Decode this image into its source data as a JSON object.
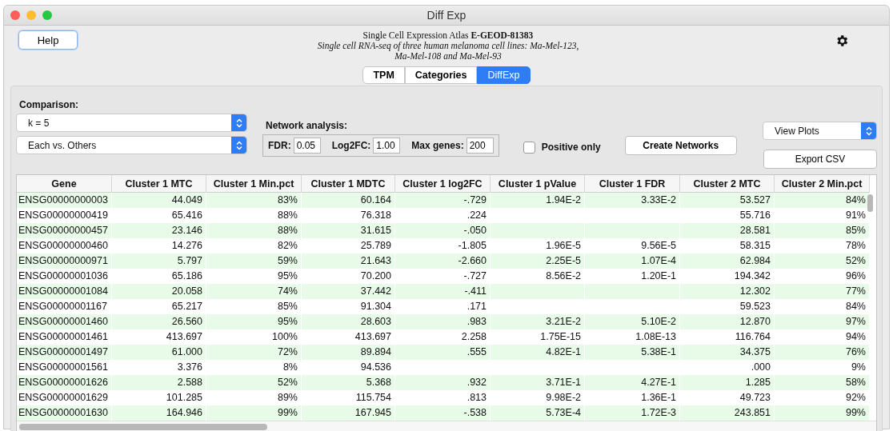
{
  "window": {
    "title": "Diff Exp"
  },
  "header": {
    "help_button": "Help",
    "atlas_line": "Single Cell Expression Atlas **E-GEOD-81383**",
    "description_lines": [
      "Single cell RNA-seq of three human melanoma cell lines: Ma-Mel-123,",
      "Ma-Mel-108 and Ma-Mel-93"
    ]
  },
  "tabs": [
    {
      "label": "TPM",
      "selected": false
    },
    {
      "label": "Categories",
      "selected": false
    },
    {
      "label": "DiffExp",
      "selected": true
    }
  ],
  "comparison": {
    "label": "Comparison:",
    "k_select": "k = 5",
    "mode_select": "Each vs. Others"
  },
  "network_analysis": {
    "label": "Network analysis:",
    "fields": [
      {
        "label": "FDR:",
        "value": "0.05"
      },
      {
        "label": "Log2FC:",
        "value": "1.00"
      },
      {
        "label": "Max genes:",
        "value": "200"
      }
    ]
  },
  "positive_only": {
    "label": "Positive only",
    "checked": false
  },
  "buttons": {
    "create_networks": "Create Networks",
    "export_csv": "Export CSV",
    "view_plots_select": "View Plots"
  },
  "table": {
    "columns": [
      "Gene",
      "Cluster 1 MTC",
      "Cluster 1 Min.pct",
      "Cluster 1 MDTC",
      "Cluster 1 log2FC",
      "Cluster 1 pValue",
      "Cluster 1 FDR",
      "Cluster 2 MTC",
      "Cluster 2 Min.pct"
    ],
    "rows": [
      [
        "ENSG00000000003",
        "44.049",
        "83%",
        "60.164",
        "-.729",
        "1.94E-2",
        "3.33E-2",
        "53.527",
        "84%"
      ],
      [
        "ENSG00000000419",
        "65.416",
        "88%",
        "76.318",
        ".224",
        null,
        null,
        "55.716",
        "91%"
      ],
      [
        "ENSG00000000457",
        "23.146",
        "88%",
        "31.615",
        "-.050",
        null,
        null,
        "28.581",
        "85%"
      ],
      [
        "ENSG00000000460",
        "14.276",
        "82%",
        "25.789",
        "-1.805",
        "1.96E-5",
        "9.56E-5",
        "58.315",
        "78%"
      ],
      [
        "ENSG00000000971",
        "5.797",
        "59%",
        "21.643",
        "-2.660",
        "2.25E-5",
        "1.07E-4",
        "62.984",
        "52%"
      ],
      [
        "ENSG00000001036",
        "65.186",
        "95%",
        "70.200",
        "-.727",
        "8.56E-2",
        "1.20E-1",
        "194.342",
        "96%"
      ],
      [
        "ENSG00000001084",
        "20.058",
        "74%",
        "37.442",
        "-.411",
        null,
        null,
        "12.302",
        "77%"
      ],
      [
        "ENSG00000001167",
        "65.217",
        "85%",
        "91.304",
        ".171",
        null,
        null,
        "59.523",
        "84%"
      ],
      [
        "ENSG00000001460",
        "26.560",
        "95%",
        "28.603",
        ".983",
        "3.21E-2",
        "5.10E-2",
        "12.870",
        "97%"
      ],
      [
        "ENSG00000001461",
        "413.697",
        "100%",
        "413.697",
        "2.258",
        "1.75E-15",
        "1.08E-13",
        "116.764",
        "94%"
      ],
      [
        "ENSG00000001497",
        "61.000",
        "72%",
        "89.894",
        ".555",
        "4.82E-1",
        "5.38E-1",
        "34.375",
        "76%"
      ],
      [
        "ENSG00000001561",
        "3.376",
        "8%",
        "94.536",
        null,
        null,
        null,
        ".000",
        "9%"
      ],
      [
        "ENSG00000001626",
        "2.588",
        "52%",
        "5.368",
        ".932",
        "3.71E-1",
        "4.27E-1",
        "1.285",
        "58%"
      ],
      [
        "ENSG00000001629",
        "101.285",
        "89%",
        "115.754",
        ".813",
        "9.98E-2",
        "1.36E-1",
        "49.723",
        "92%"
      ],
      [
        "ENSG00000001630",
        "164.946",
        "99%",
        "167.945",
        "-.538",
        "5.73E-4",
        "1.72E-3",
        "243.851",
        "99%"
      ]
    ]
  }
}
